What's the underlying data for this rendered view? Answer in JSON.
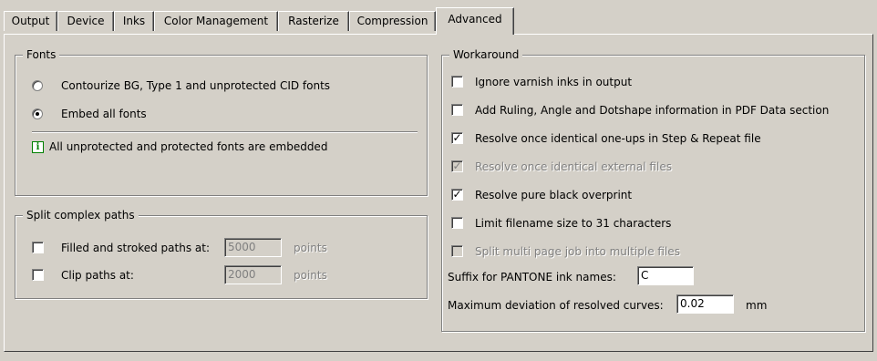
{
  "tabs": [
    {
      "label": "Output"
    },
    {
      "label": "Device"
    },
    {
      "label": "Inks"
    },
    {
      "label": "Color Management"
    },
    {
      "label": "Rasterize"
    },
    {
      "label": "Compression"
    },
    {
      "label": "Advanced",
      "active": true
    }
  ],
  "fonts": {
    "title": "Fonts",
    "option_contourize": "Contourize BG, Type 1 and unprotected CID fonts",
    "option_embed": "Embed all fonts",
    "info_icon": "info-icon",
    "info_text": "All unprotected and protected fonts are embedded"
  },
  "split": {
    "title": "Split complex paths",
    "filled_label": "Filled and stroked paths at:",
    "filled_value": "5000",
    "filled_unit": "points",
    "clip_label": "Clip paths at:",
    "clip_value": "2000",
    "clip_unit": "points"
  },
  "workaround": {
    "title": "Workaround",
    "items": [
      {
        "label": "Ignore varnish inks in output",
        "checked": false,
        "enabled": true
      },
      {
        "label": "Add Ruling, Angle and Dotshape information in PDF Data section",
        "checked": false,
        "enabled": true
      },
      {
        "label": "Resolve once identical one-ups in Step & Repeat file",
        "checked": true,
        "enabled": true
      },
      {
        "label": "Resolve once identical external files",
        "checked": true,
        "enabled": false
      },
      {
        "label": "Resolve pure black overprint",
        "checked": true,
        "enabled": true
      },
      {
        "label": "Limit filename size to 31 characters",
        "checked": false,
        "enabled": true
      },
      {
        "label": "Split multi page job into multiple files",
        "checked": false,
        "enabled": false
      }
    ],
    "suffix_label": "Suffix for PANTONE ink names:",
    "suffix_value": "C",
    "deviation_label": "Maximum deviation of resolved curves:",
    "deviation_value": "0.02",
    "deviation_unit": "mm"
  }
}
